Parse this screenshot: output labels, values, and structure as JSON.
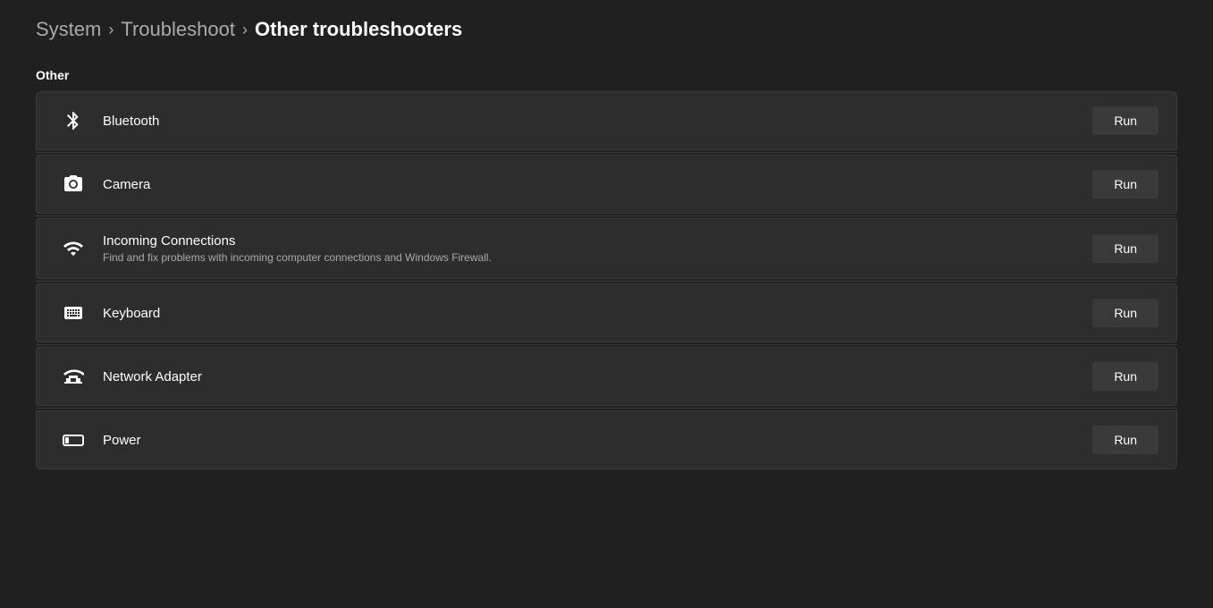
{
  "breadcrumb": {
    "items": [
      {
        "label": "System",
        "active": false
      },
      {
        "label": "Troubleshoot",
        "active": false
      },
      {
        "label": "Other troubleshooters",
        "active": true
      }
    ],
    "separators": [
      ">",
      ">"
    ]
  },
  "section": {
    "label": "Other"
  },
  "troubleshooters": [
    {
      "id": "bluetooth",
      "name": "Bluetooth",
      "description": "",
      "icon": "bluetooth",
      "button_label": "Run"
    },
    {
      "id": "camera",
      "name": "Camera",
      "description": "",
      "icon": "camera",
      "button_label": "Run"
    },
    {
      "id": "incoming-connections",
      "name": "Incoming Connections",
      "description": "Find and fix problems with incoming computer connections and Windows Firewall.",
      "icon": "incoming-connections",
      "button_label": "Run"
    },
    {
      "id": "keyboard",
      "name": "Keyboard",
      "description": "",
      "icon": "keyboard",
      "button_label": "Run"
    },
    {
      "id": "network-adapter",
      "name": "Network Adapter",
      "description": "",
      "icon": "network-adapter",
      "button_label": "Run"
    },
    {
      "id": "power",
      "name": "Power",
      "description": "",
      "icon": "power",
      "button_label": "Run"
    }
  ]
}
